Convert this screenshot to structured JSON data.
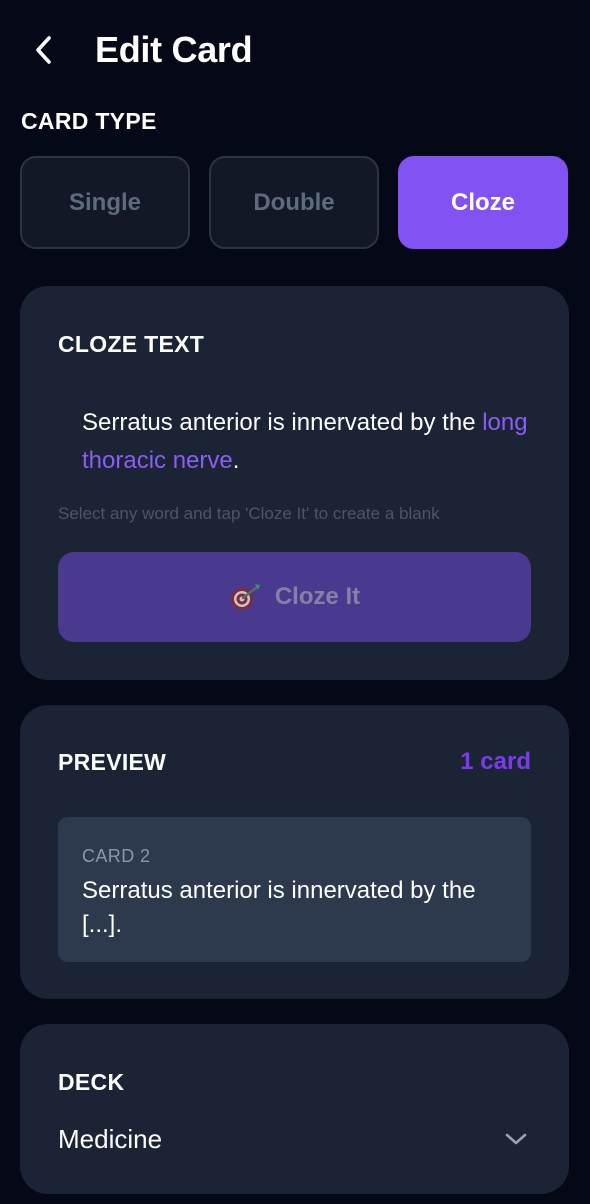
{
  "header": {
    "title": "Edit Card"
  },
  "card_type": {
    "label": "CARD TYPE",
    "options": [
      "Single",
      "Double",
      "Cloze"
    ],
    "selected": "Cloze"
  },
  "cloze": {
    "title": "CLOZE TEXT",
    "text_before": "Serratus anterior is innervated by the ",
    "highlight": "long thoracic nerve",
    "text_after": ".",
    "hint": "Select any word and tap 'Cloze It' to create a blank",
    "button_label": "Cloze It",
    "button_icon": "target-dart-icon"
  },
  "preview": {
    "title": "PREVIEW",
    "count": "1 card",
    "items": [
      {
        "label": "CARD 2",
        "text": "Serratus anterior is innervated by the [...]."
      }
    ]
  },
  "deck": {
    "title": "DECK",
    "value": "Medicine"
  },
  "colors": {
    "background": "#050816",
    "card": "#1b2434",
    "accent": "#8352f2",
    "highlight": "#8b5cf6"
  }
}
